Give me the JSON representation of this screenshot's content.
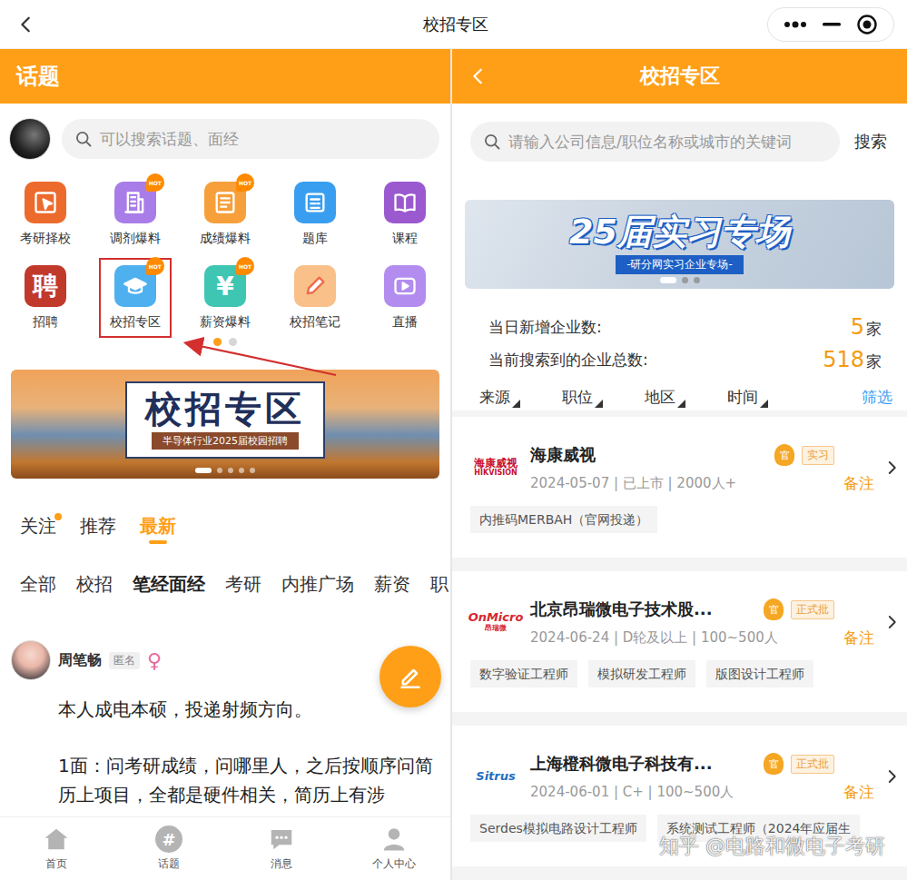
{
  "topbar": {
    "title": "校招专区"
  },
  "left": {
    "header": "话题",
    "search_placeholder": "可以搜索话题、面经",
    "grid": [
      {
        "label": "考研择校",
        "color": "#ec6a2c",
        "badge": "",
        "glyph": "",
        "highlighted": false
      },
      {
        "label": "调剂爆料",
        "color": "#a97de8",
        "badge": "HOT",
        "glyph": "",
        "highlighted": false
      },
      {
        "label": "成绩爆料",
        "color": "#f7a03b",
        "badge": "HOT",
        "glyph": "",
        "highlighted": false
      },
      {
        "label": "题库",
        "color": "#3a9ef0",
        "badge": "",
        "glyph": "",
        "highlighted": false
      },
      {
        "label": "课程",
        "color": "#9b59d0",
        "badge": "",
        "glyph": "",
        "highlighted": false
      },
      {
        "label": "招聘",
        "color": "#c0392b",
        "badge": "",
        "glyph": "聘",
        "highlighted": false
      },
      {
        "label": "校招专区",
        "color": "#4fb0f0",
        "badge": "HOT",
        "glyph": "",
        "highlighted": true
      },
      {
        "label": "薪资爆料",
        "color": "#3fc6b3",
        "badge": "HOT",
        "glyph": "¥",
        "highlighted": false
      },
      {
        "label": "校招笔记",
        "color": "#f9c08a",
        "badge": "",
        "glyph": "",
        "highlighted": false
      },
      {
        "label": "直播",
        "color": "#b38cf0",
        "badge": "",
        "glyph": "",
        "highlighted": false
      }
    ],
    "grid_pages": [
      {
        "selected": true
      },
      {
        "selected": false
      }
    ],
    "banner": {
      "title": "校招专区",
      "subtitle": "半导体行业2025届校园招聘",
      "dots": [
        {
          "selected": true
        },
        {
          "selected": false
        },
        {
          "selected": false
        },
        {
          "selected": false
        },
        {
          "selected": false
        }
      ]
    },
    "feed_tabs": [
      {
        "label": "关注",
        "selected": false,
        "dot": true
      },
      {
        "label": "推荐",
        "selected": false,
        "dot": false
      },
      {
        "label": "最新",
        "selected": true,
        "dot": false
      }
    ],
    "categories": [
      {
        "label": "全部",
        "selected": false
      },
      {
        "label": "校招",
        "selected": false
      },
      {
        "label": "笔经面经",
        "selected": true
      },
      {
        "label": "考研",
        "selected": false
      },
      {
        "label": "内推广场",
        "selected": false
      },
      {
        "label": "薪资",
        "selected": false
      },
      {
        "label": "职",
        "selected": false
      }
    ],
    "post": {
      "author": "周笔畅",
      "tag": "匿名",
      "gender": "♀",
      "paragraphs": [
        "本人成电本硕，投递射频方向。",
        "1面：问考研成绩，问哪里人，之后按顺序问简历上项目，全都是硬件相关，简历上有涉"
      ]
    },
    "nav": [
      {
        "label": "首页",
        "glyph": "",
        "selected": false
      },
      {
        "label": "话题",
        "glyph": "#",
        "selected": false
      },
      {
        "label": "消息",
        "glyph": "",
        "selected": false
      },
      {
        "label": "个人中心",
        "glyph": "",
        "selected": false
      }
    ]
  },
  "right": {
    "header": "校招专区",
    "search_placeholder": "请输入公司信息/职位名称或城市的关键词",
    "search_button": "搜索",
    "banner": {
      "title": "25届实习专场",
      "subtitle": "-研分网实习企业专场-",
      "dots": [
        {
          "selected": true
        },
        {
          "selected": false
        },
        {
          "selected": false
        }
      ]
    },
    "stats": [
      {
        "label": "当日新增企业数:",
        "value": "5",
        "unit": "家"
      },
      {
        "label": "当前搜索到的企业总数:",
        "value": "518",
        "unit": "家"
      }
    ],
    "filters": [
      {
        "label": "来源",
        "dropdown": true
      },
      {
        "label": "职位",
        "dropdown": true
      },
      {
        "label": "地区",
        "dropdown": true
      },
      {
        "label": "时间",
        "dropdown": true
      },
      {
        "label": "筛选",
        "dropdown": false
      }
    ],
    "companies": [
      {
        "logo": {
          "text": "海康威视",
          "sub": "HIKVISION",
          "color": "#c8102e"
        },
        "name": "海康威视",
        "mark": "官",
        "badge": "实习",
        "meta": "2024-05-07 | 已上市 | 2000人+",
        "note": "备注",
        "tags": [
          "内推码MERBAH（官网投递）"
        ]
      },
      {
        "logo": {
          "text": "OnMicro",
          "sub": "昂瑞微",
          "color": "#d7282f"
        },
        "name": "北京昂瑞微电子技术股...",
        "mark": "官",
        "badge": "正式批",
        "meta": "2024-06-24 | D轮及以上 | 100~500人",
        "note": "备注",
        "tags": [
          "数字验证工程师",
          "模拟研发工程师",
          "版图设计工程师"
        ]
      },
      {
        "logo": {
          "text": "Sitrus",
          "sub": "",
          "color": "#1f6fc0"
        },
        "name": "上海橙科微电子科技有...",
        "mark": "官",
        "badge": "正式批",
        "meta": "2024-06-01 | C+ | 100~500人",
        "note": "备注",
        "tags": [
          "Serdes模拟电路设计工程师",
          "系统测试工程师（2024年应届生"
        ]
      }
    ]
  },
  "watermark": "知乎 @电路和微电子考研"
}
